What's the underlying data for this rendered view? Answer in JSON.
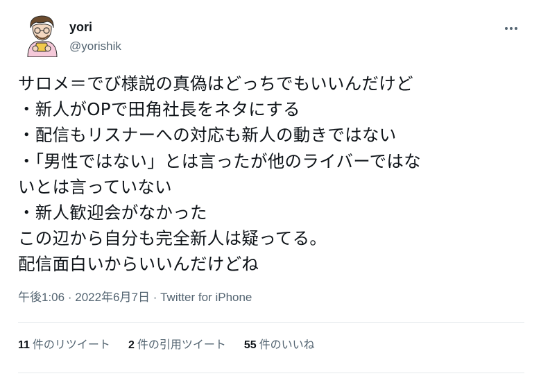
{
  "author": {
    "display_name": "yori",
    "handle": "@yorishik",
    "avatar": "avatar-illustration"
  },
  "more_icon": "more-horizontal-icon",
  "tweet": {
    "lines": [
      "サロメ＝でび様説の真偽はどっちでもいいんだけど",
      "・新人がOPで田角社長をネタにする",
      "・配信もリスナーへの対応も新人の動きではない",
      "・「男性ではない」とは言ったが他のライバーではな",
      "いとは言っていない",
      "・新人歓迎会がなかった",
      "この辺から自分も完全新人は疑ってる。",
      "配信面白いからいいんだけどね"
    ]
  },
  "meta": {
    "time": "午後1:06",
    "separator": "·",
    "date": "2022年6月7日",
    "source": "Twitter for iPhone"
  },
  "stats": {
    "retweets": {
      "count": "11",
      "label": "件のリツイート"
    },
    "quotes": {
      "count": "2",
      "label": "件の引用ツイート"
    },
    "likes": {
      "count": "55",
      "label": "件のいいね"
    }
  },
  "colors": {
    "text": "#0f1419",
    "secondary": "#536471",
    "divider": "#e4e8eb"
  }
}
